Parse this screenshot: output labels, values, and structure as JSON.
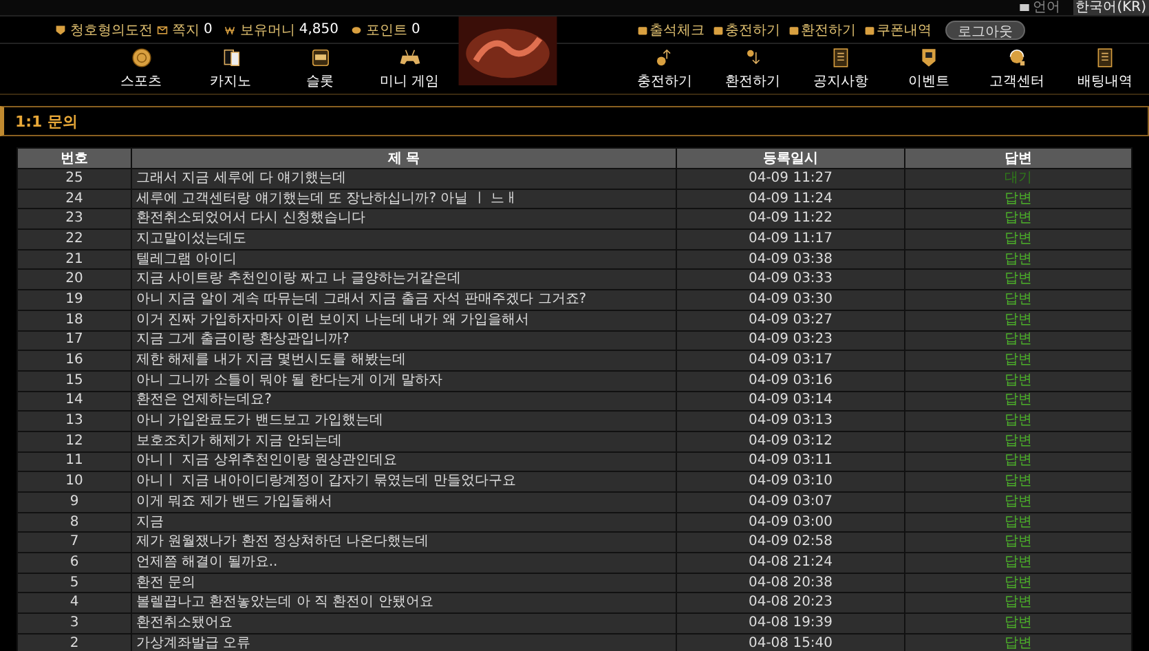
{
  "top_bar": {
    "language_label": "언어",
    "language": "한국어(KR)"
  },
  "account": {
    "rank": "청호형의도전",
    "messages_label": "쪽지",
    "messages": "0",
    "money_label": "보유머니",
    "money": "4,850",
    "points_label": "포인트",
    "points": "0"
  },
  "user_links": [
    "출석체크",
    "충전하기",
    "환전하기",
    "쿠폰내역"
  ],
  "logout": "로그아웃",
  "nav_left": [
    {
      "label": "스포츠",
      "kind": "coin"
    },
    {
      "label": "카지노",
      "kind": "cards"
    },
    {
      "label": "슬롯",
      "kind": "slot"
    },
    {
      "label": "미니 게임",
      "kind": "gamepad"
    }
  ],
  "nav_right": [
    {
      "label": "충전하기",
      "kind": "deposit"
    },
    {
      "label": "환전하기",
      "kind": "withdraw"
    },
    {
      "label": "공지사항",
      "kind": "board"
    },
    {
      "label": "이벤트",
      "kind": "event"
    },
    {
      "label": "고객센터",
      "kind": "support"
    },
    {
      "label": "배팅내역",
      "kind": "board"
    }
  ],
  "page_title": "1:1 문의",
  "table": {
    "columns": [
      "번호",
      "제 목",
      "등록일시",
      "답변"
    ],
    "rows": [
      {
        "no": "25",
        "title": "그래서 지금 세루에 다 얘기했는데",
        "date": "04-09 11:27",
        "status": "대기",
        "answered": false
      },
      {
        "no": "24",
        "title": "세루에 고객센터랑 얘기했는데 또 장난하십니까? 아닐 ㅣ 느ㅐ",
        "date": "04-09 11:24",
        "status": "답변",
        "answered": true
      },
      {
        "no": "23",
        "title": "환전취소되었어서 다시 신청했습니다",
        "date": "04-09 11:22",
        "status": "답변",
        "answered": true
      },
      {
        "no": "22",
        "title": "지고말이섰는데도",
        "date": "04-09 11:17",
        "status": "답변",
        "answered": true
      },
      {
        "no": "21",
        "title": "텔레그램 아이디",
        "date": "04-09 03:38",
        "status": "답변",
        "answered": true
      },
      {
        "no": "20",
        "title": "지금 사이트랑 추천인이랑 짜고 나 글양하는거같은데",
        "date": "04-09 03:33",
        "status": "답변",
        "answered": true
      },
      {
        "no": "19",
        "title": "아니 지금 알이 계속 따뮤는데 그래서 지금 출금 자석 판매주겠다 그거죠?",
        "date": "04-09 03:30",
        "status": "답변",
        "answered": true
      },
      {
        "no": "18",
        "title": "이거 진짜 가입하자마자 이런 보이지 나는데 내가 왜 가입을해서",
        "date": "04-09 03:27",
        "status": "답변",
        "answered": true
      },
      {
        "no": "17",
        "title": "지금 그게 출금이랑 환상관입니까?",
        "date": "04-09 03:23",
        "status": "답변",
        "answered": true
      },
      {
        "no": "16",
        "title": "제한 해제를 내가 지금 몇번시도를 해봤는데",
        "date": "04-09 03:17",
        "status": "답변",
        "answered": true
      },
      {
        "no": "15",
        "title": "아니 그니까 소틀이 뭐야 될 한다는게 이게 말하자",
        "date": "04-09 03:16",
        "status": "답변",
        "answered": true
      },
      {
        "no": "14",
        "title": "환전은 언제하는데요?",
        "date": "04-09 03:14",
        "status": "답변",
        "answered": true
      },
      {
        "no": "13",
        "title": "아니 가입완료도가 밴드보고 가입했는데",
        "date": "04-09 03:13",
        "status": "답변",
        "answered": true
      },
      {
        "no": "12",
        "title": "보호조치가 해제가 지금 안되는데",
        "date": "04-09 03:12",
        "status": "답변",
        "answered": true
      },
      {
        "no": "11",
        "title": "아니ㅣ 지금 상위추천인이랑 원상관인데요",
        "date": "04-09 03:11",
        "status": "답변",
        "answered": true
      },
      {
        "no": "10",
        "title": "아니ㅣ 지금 내아이디랑계정이 갑자기 묶였는데 만들었다구요",
        "date": "04-09 03:10",
        "status": "답변",
        "answered": true
      },
      {
        "no": "9",
        "title": "이게 뭐죠 제가 밴드 가입돌해서",
        "date": "04-09 03:07",
        "status": "답변",
        "answered": true
      },
      {
        "no": "8",
        "title": "지금",
        "date": "04-09 03:00",
        "status": "답변",
        "answered": true
      },
      {
        "no": "7",
        "title": "제가 원월쟀나가 환전 정상쳐하던 나온다했는데",
        "date": "04-09 02:58",
        "status": "답변",
        "answered": true
      },
      {
        "no": "6",
        "title": "언제쯤 해결이 될까요..",
        "date": "04-08 21:24",
        "status": "답변",
        "answered": true
      },
      {
        "no": "5",
        "title": "환전 문의",
        "date": "04-08 20:38",
        "status": "답변",
        "answered": true
      },
      {
        "no": "4",
        "title": "볼렐끕나고 환전놓았는데 아 직 환전이 안됐어요",
        "date": "04-08 20:23",
        "status": "답변",
        "answered": true
      },
      {
        "no": "3",
        "title": "환전취소됐어요",
        "date": "04-08 19:39",
        "status": "답변",
        "answered": true
      },
      {
        "no": "2",
        "title": "가상계좌발급 오류",
        "date": "04-08 15:40",
        "status": "답변",
        "answered": true
      }
    ]
  }
}
